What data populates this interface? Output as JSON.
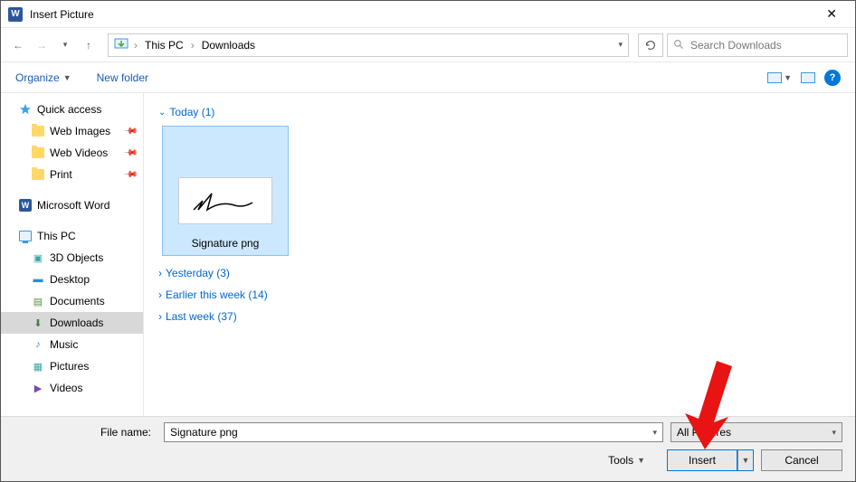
{
  "title": "Insert Picture",
  "nav": {
    "breadcrumb_root": "This PC",
    "breadcrumb_leaf": "Downloads",
    "search_placeholder": "Search Downloads"
  },
  "toolbar": {
    "organize": "Organize",
    "newfolder": "New folder"
  },
  "sidebar": {
    "quick": "Quick access",
    "items_pinned": [
      {
        "label": "Web Images"
      },
      {
        "label": "Web Videos"
      },
      {
        "label": "Print"
      }
    ],
    "msword": "Microsoft Word",
    "thispc": "This PC",
    "pclist": [
      {
        "label": "3D Objects",
        "color": "#3aa6a6"
      },
      {
        "label": "Desktop",
        "color": "#1e90d8"
      },
      {
        "label": "Documents",
        "color": "#5a8f3d"
      },
      {
        "label": "Downloads",
        "color": "#4a7a4a"
      },
      {
        "label": "Music",
        "color": "#1e90d8"
      },
      {
        "label": "Pictures",
        "color": "#3aa6a6"
      },
      {
        "label": "Videos",
        "color": "#7a4aa6"
      }
    ]
  },
  "content": {
    "group_open": "Today (1)",
    "file_name": "Signature png",
    "groups_closed": [
      "Yesterday (3)",
      "Earlier this week (14)",
      "Last week (37)"
    ]
  },
  "footer": {
    "fn_label": "File name:",
    "fn_value": "Signature png",
    "filter": "All Pictures",
    "tools": "Tools",
    "insert": "Insert",
    "cancel": "Cancel"
  }
}
